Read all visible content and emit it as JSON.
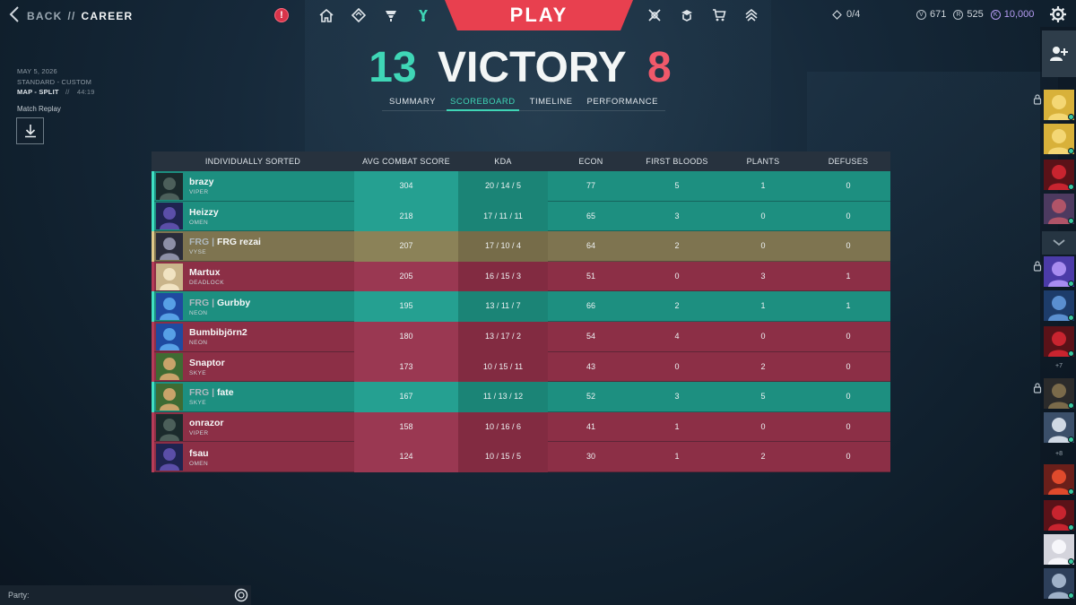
{
  "header": {
    "back_label": "BACK",
    "sep": "//",
    "section_label": "CAREER",
    "play_label": "PLAY",
    "alert_icon": "!",
    "counter": "0/4",
    "currencies": [
      {
        "icon": "valorant-points-icon",
        "value": "671"
      },
      {
        "icon": "radianite-icon",
        "value": "525"
      },
      {
        "icon": "kingdom-credits-icon",
        "value": "10,000"
      }
    ]
  },
  "match": {
    "date": "MAY 5, 2026",
    "mode": "STANDARD - CUSTOM",
    "map": "MAP - SPLIT",
    "sep": "//",
    "duration": "44:19",
    "replay_label": "Match Replay"
  },
  "score": {
    "team_score": "13",
    "result": "VICTORY",
    "enemy_score": "8"
  },
  "tabs": [
    "SUMMARY",
    "SCOREBOARD",
    "TIMELINE",
    "PERFORMANCE"
  ],
  "table": {
    "headers": [
      "INDIVIDUALLY SORTED",
      "AVG COMBAT SCORE",
      "KDA",
      "ECON",
      "FIRST BLOODS",
      "PLANTS",
      "DEFUSES"
    ],
    "rows": [
      {
        "tag": "",
        "name": "brazy",
        "agent": "VIPER",
        "acs": "304",
        "kda": "20 / 14 / 5",
        "econ": "77",
        "fb": "5",
        "plants": "1",
        "defuses": "0",
        "team": "win"
      },
      {
        "tag": "",
        "name": "Heizzy",
        "agent": "OMEN",
        "acs": "218",
        "kda": "17 / 11 / 11",
        "econ": "65",
        "fb": "3",
        "plants": "0",
        "defuses": "0",
        "team": "win"
      },
      {
        "tag": "FRG | ",
        "name": "FRG rezai",
        "agent": "VYSE",
        "acs": "207",
        "kda": "17 / 10 / 4",
        "econ": "64",
        "fb": "2",
        "plants": "0",
        "defuses": "0",
        "team": "self"
      },
      {
        "tag": "",
        "name": "Martux",
        "agent": "DEADLOCK",
        "acs": "205",
        "kda": "16 / 15 / 3",
        "econ": "51",
        "fb": "0",
        "plants": "3",
        "defuses": "1",
        "team": "loss"
      },
      {
        "tag": "FRG | ",
        "name": "Gurbby",
        "agent": "NEON",
        "acs": "195",
        "kda": "13 / 11 / 7",
        "econ": "66",
        "fb": "2",
        "plants": "1",
        "defuses": "1",
        "team": "win"
      },
      {
        "tag": "",
        "name": "Bumbibjörn2",
        "agent": "NEON",
        "acs": "180",
        "kda": "13 / 17 / 2",
        "econ": "54",
        "fb": "4",
        "plants": "0",
        "defuses": "0",
        "team": "loss"
      },
      {
        "tag": "",
        "name": "Snaptor",
        "agent": "SKYE",
        "acs": "173",
        "kda": "10 / 15 / 11",
        "econ": "43",
        "fb": "0",
        "plants": "2",
        "defuses": "0",
        "team": "loss"
      },
      {
        "tag": "FRG | ",
        "name": "fate",
        "agent": "SKYE",
        "acs": "167",
        "kda": "11 / 13 / 12",
        "econ": "52",
        "fb": "3",
        "plants": "5",
        "defuses": "0",
        "team": "win"
      },
      {
        "tag": "",
        "name": "onrazor",
        "agent": "VIPER",
        "acs": "158",
        "kda": "10 / 16 / 6",
        "econ": "41",
        "fb": "1",
        "plants": "0",
        "defuses": "0",
        "team": "loss"
      },
      {
        "tag": "",
        "name": "fsau",
        "agent": "OMEN",
        "acs": "124",
        "kda": "10 / 15 / 5",
        "econ": "30",
        "fb": "1",
        "plants": "2",
        "defuses": "0",
        "team": "loss"
      }
    ]
  },
  "social": {
    "overflow_1": "+7",
    "overflow_2": "+8"
  },
  "party": {
    "label": "Party:"
  },
  "colors": {
    "win": "#1d8f80",
    "loss": "#8c2f46",
    "self": "#7e7450",
    "accent": "#3fd6b6",
    "enemy": "#f0596a",
    "play": "#e8404f"
  }
}
